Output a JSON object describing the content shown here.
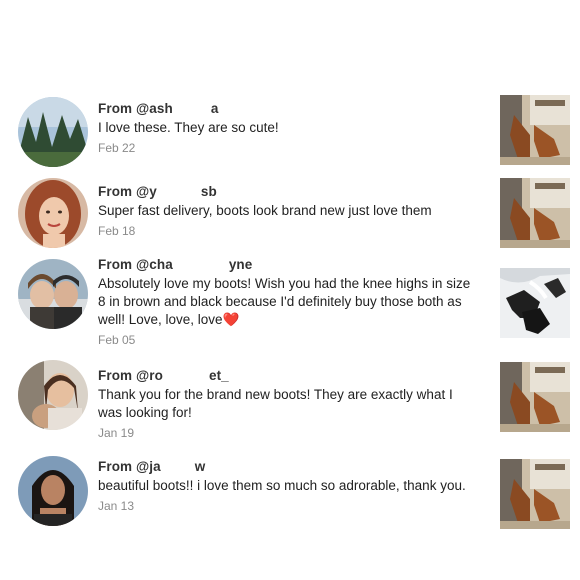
{
  "reviews": [
    {
      "from_prefix": "From @ash",
      "from_suffix": "a",
      "text": "I love these. They are so cute!",
      "date": "Feb 22",
      "avatar": "forest-landscape-avatar",
      "thumbnail": "brown-boots-photo"
    },
    {
      "from_prefix": "From @y",
      "from_suffix": "sb",
      "text": "Super fast delivery, boots look brand new just love them",
      "date": "Feb 18",
      "avatar": "woman-red-hair-avatar",
      "thumbnail": "brown-boots-photo"
    },
    {
      "from_prefix": "From @cha",
      "from_suffix": "yne",
      "text": "Absolutely love my boots! Wish you had the knee highs in size 8 in brown and black because I'd definitely buy those both as well! Love, love, love",
      "emoji": "❤️",
      "date": "Feb 05",
      "avatar": "couple-avatar",
      "thumbnail": "black-boots-snow-photo"
    },
    {
      "from_prefix": "From @ro",
      "from_suffix": "et_",
      "text": "Thank you for the brand new boots! They are exactly what I was looking for!",
      "date": "Jan 19",
      "avatar": "woman-with-baby-avatar",
      "thumbnail": "brown-boots-photo"
    },
    {
      "from_prefix": "From @ja",
      "from_suffix": "w",
      "text": "beautiful boots!! i love them so much so adrorable, thank you.",
      "date": "Jan 13",
      "avatar": "woman-dark-hair-avatar",
      "thumbnail": "brown-boots-photo"
    }
  ]
}
